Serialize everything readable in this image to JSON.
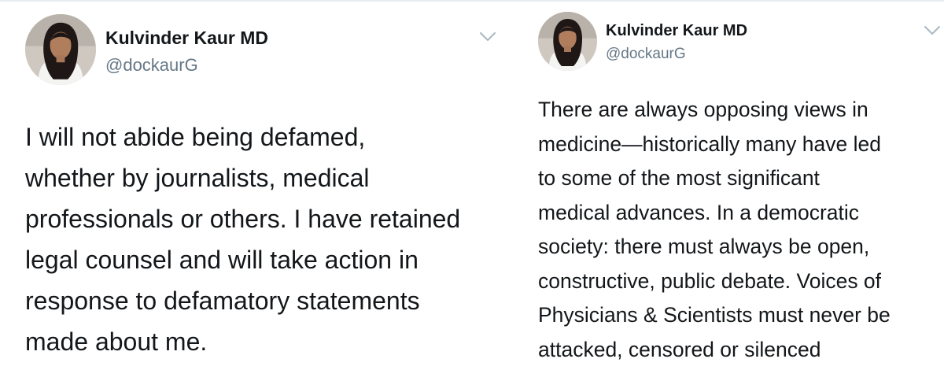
{
  "tweets": [
    {
      "author": {
        "name": "Kulvinder Kaur MD",
        "handle": "@dockaurG"
      },
      "menu_icon": "chevron-down-icon",
      "text": "I will not abide being defamed,\nwhether by journalists, medical\nprofessionals or others. I have retained\nlegal counsel and will take action in\nresponse to defamatory statements\nmade about me."
    },
    {
      "author": {
        "name": "Kulvinder Kaur MD",
        "handle": "@dockaurG"
      },
      "menu_icon": "chevron-down-icon",
      "text": "There are always opposing views in\nmedicine—historically many have led\nto some of the most significant\nmedical advances. In a democratic\nsociety: there must always be open,\nconstructive, public debate. Voices of\nPhysicians & Scientists must never be\nattacked, censored or silenced"
    }
  ],
  "colors": {
    "text": "#14171a",
    "secondary": "#657786",
    "chevron": "#aab8c2",
    "divider": "#e6ecf0"
  }
}
